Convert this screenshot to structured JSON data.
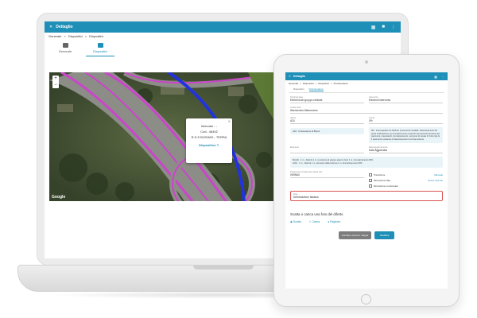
{
  "laptop": {
    "app_title": "Dettaglio",
    "breadcrumbs": [
      "Generale",
      ">",
      "Dispositivi",
      ">",
      "Dispositivi"
    ],
    "tabs": [
      {
        "label": "Generale",
        "active": false
      },
      {
        "label": "Dispositivi",
        "active": true
      }
    ],
    "map": {
      "zoom_in": "+",
      "zoom_out": "−",
      "popup": {
        "line1": "Intervalo - -",
        "line2": "Cod.: 46402",
        "line3": "R.S.S BOSWID - TERRA",
        "link": "Dispositivo"
      },
      "attribution": "Google"
    }
  },
  "tablet": {
    "app_title": "Dettaglio",
    "breadcrumbs": [
      "Generale",
      ">",
      "Dispositivi",
      ">",
      "Dispositivi",
      ">",
      "Posizionatore"
    ],
    "tabs": [
      {
        "label": "Dispositivi",
        "active": false
      },
      {
        "label": "Posizionatore",
        "active": true
      }
    ],
    "fields": {
      "tipologia_label": "Tipologia fase",
      "tipologia_value": "Elementi del gruppo centrale",
      "intervento_label": "Intervento",
      "intervento_value": "Elementi intervento",
      "codice_label": "Codice fase",
      "codice_value": "Warmevens Warmevens",
      "codice_val_label": "Valore",
      "codice_val_value": "A24",
      "quota_label": "Quota",
      "quota_value": "0%",
      "chip": "A24 · Possessione di Buoni",
      "note": "M5 · Intercapedine tra l'Erba E il pavimento stradale. Deterioramento dei giunti di dilatazione (o) Ammaloramento profondo dei bordi del ripristino dei pavimenti, preesistenti. Ammaloramento, sul ponte di canale 0.3 dei cigli, E il pavimento esistente di deterioramento di conservazione.",
      "elemento_label": "Elemento",
      "elemento_value": "",
      "elemento_side_label": "Data aggiornamento",
      "elemento_side_value": "Data Aggiornata",
      "body_text_1": "BLAVA · 1 m · Altezza 1 m, la colonna di gruppo esterno fuori 1 m. Ammaloramento 50%",
      "body_text_2": "ALTA · 1 m · Altezza 1 m, elemento della colonna 1 m. Ammaloramento 50%",
      "progressivo_label": "Progressivo di stato del codice coll.",
      "progressivo_value": "00NNA0",
      "descrizione_label": "Note",
      "descrizione_value": "Deformazione bassica"
    },
    "checks": [
      {
        "label": "Transizione",
        "action": "Manuale"
      },
      {
        "label": "Ricevazione NE+",
        "action": "Nuove ricerche"
      },
      {
        "label": "Ricevazione condensata",
        "action": ""
      }
    ],
    "photo": {
      "title": "Scatta o carica una foto del difetto",
      "actions": [
        "Scatta",
        "Carica",
        "Registra"
      ]
    },
    "buttons": {
      "cancel": "Annulla e torna in mappa",
      "save": "Modifica"
    }
  },
  "colors": {
    "brand_blue": "#1e8fb7",
    "road_highlight": "#cc44cc",
    "road_blue": "#2233dd",
    "error_red": "#d9534f"
  }
}
